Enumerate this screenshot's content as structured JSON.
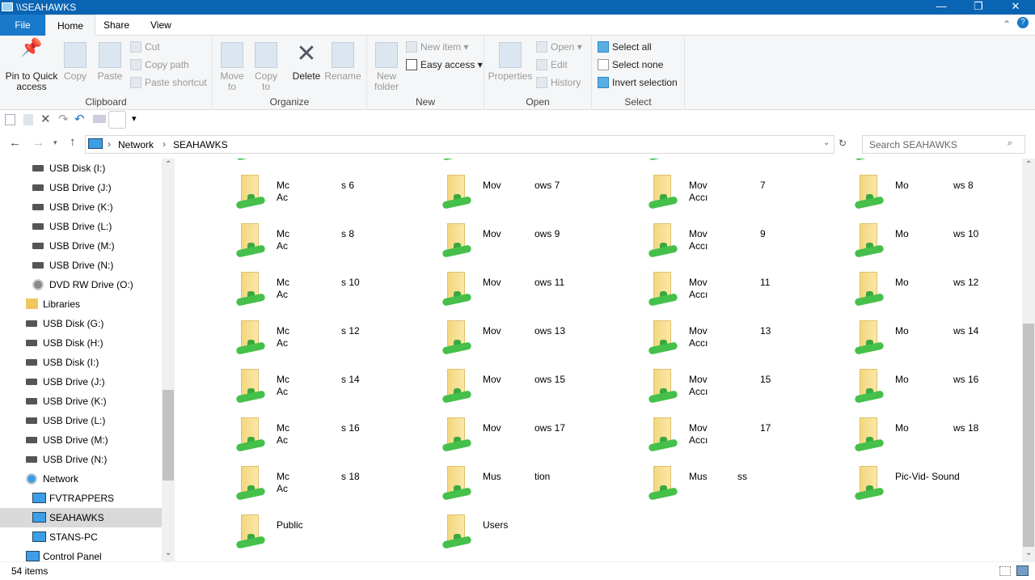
{
  "window": {
    "title": "\\\\SEAHAWKS",
    "minimize": "—",
    "maximize": "❐",
    "close": "✕"
  },
  "tabs": [
    {
      "label": "File"
    },
    {
      "label": "Home"
    },
    {
      "label": "Share"
    },
    {
      "label": "View"
    }
  ],
  "ribbon": {
    "clipboard": {
      "label": "Clipboard",
      "pin": "Pin to Quick access",
      "copy": "Copy",
      "paste": "Paste",
      "cut": "Cut",
      "copy_path": "Copy path",
      "paste_shortcut": "Paste shortcut"
    },
    "organize": {
      "label": "Organize",
      "move_to": "Move to",
      "copy_to": "Copy to",
      "delete": "Delete",
      "rename": "Rename"
    },
    "new": {
      "label": "New",
      "new_folder": "New folder",
      "new_item": "New item",
      "easy_access": "Easy access"
    },
    "open": {
      "label": "Open",
      "properties": "Properties",
      "open": "Open",
      "edit": "Edit",
      "history": "History"
    },
    "select": {
      "label": "Select",
      "select_all": "Select all",
      "select_none": "Select none",
      "invert": "Invert selection"
    }
  },
  "address": {
    "crumbs": [
      "Network",
      "SEAHAWKS"
    ],
    "search_placeholder": "Search SEAHAWKS"
  },
  "nav": [
    {
      "label": "USB Disk (I:)",
      "icon": "drive",
      "indent": 1
    },
    {
      "label": "USB Drive (J:)",
      "icon": "drive",
      "indent": 1
    },
    {
      "label": "USB Drive (K:)",
      "icon": "drive",
      "indent": 1
    },
    {
      "label": "USB Drive (L:)",
      "icon": "drive",
      "indent": 1
    },
    {
      "label": "USB Drive (M:)",
      "icon": "drive",
      "indent": 1
    },
    {
      "label": "USB Drive (N:)",
      "icon": "drive",
      "indent": 1
    },
    {
      "label": "DVD RW Drive (O:)",
      "icon": "dvd",
      "indent": 1
    },
    {
      "label": "Libraries",
      "icon": "library",
      "indent": 0
    },
    {
      "label": "USB Disk (G:)",
      "icon": "drive",
      "indent": 0
    },
    {
      "label": "USB Disk (H:)",
      "icon": "drive",
      "indent": 0
    },
    {
      "label": "USB Disk (I:)",
      "icon": "drive",
      "indent": 0
    },
    {
      "label": "USB Drive (J:)",
      "icon": "drive",
      "indent": 0
    },
    {
      "label": "USB Drive (K:)",
      "icon": "drive",
      "indent": 0
    },
    {
      "label": "USB Drive (L:)",
      "icon": "drive",
      "indent": 0
    },
    {
      "label": "USB Drive (M:)",
      "icon": "drive",
      "indent": 0
    },
    {
      "label": "USB Drive (N:)",
      "icon": "drive",
      "indent": 0
    },
    {
      "label": "Network",
      "icon": "network",
      "indent": 0
    },
    {
      "label": "FVTRAPPERS",
      "icon": "computer",
      "indent": 1
    },
    {
      "label": "SEAHAWKS",
      "icon": "computer",
      "indent": 1,
      "selected": true
    },
    {
      "label": "STANS-PC",
      "icon": "computer",
      "indent": 1
    },
    {
      "label": "Control Panel",
      "icon": "control",
      "indent": 0
    }
  ],
  "rows": [
    [
      {
        "a": "Mc",
        "b": "Ac",
        "r": "s 6"
      },
      {
        "a": "Mov",
        "r": "ows 7"
      },
      {
        "a": "Mov",
        "b": "Accı",
        "r": "7"
      },
      {
        "a": "Mo",
        "r": "ws 8"
      }
    ],
    [
      {
        "a": "Mc",
        "b": "Ac",
        "r": "s 8"
      },
      {
        "a": "Mov",
        "r": "ows 9"
      },
      {
        "a": "Mov",
        "b": "Accı",
        "r": "9"
      },
      {
        "a": "Mo",
        "r": "ws 10"
      }
    ],
    [
      {
        "a": "Mc",
        "b": "Ac",
        "r": "s 10"
      },
      {
        "a": "Mov",
        "r": "ows 11"
      },
      {
        "a": "Mov",
        "b": "Accı",
        "r": "11"
      },
      {
        "a": "Mo",
        "r": "ws 12"
      }
    ],
    [
      {
        "a": "Mc",
        "b": "Ac",
        "r": "s 12"
      },
      {
        "a": "Mov",
        "r": "ows 13"
      },
      {
        "a": "Mov",
        "b": "Accı",
        "r": "13"
      },
      {
        "a": "Mo",
        "r": "ws 14"
      }
    ],
    [
      {
        "a": "Mc",
        "b": "Ac",
        "r": "s 14"
      },
      {
        "a": "Mov",
        "r": "ows 15"
      },
      {
        "a": "Mov",
        "b": "Accı",
        "r": "15"
      },
      {
        "a": "Mo",
        "r": "ws 16"
      }
    ],
    [
      {
        "a": "Mc",
        "b": "Ac",
        "r": "s 16"
      },
      {
        "a": "Mov",
        "r": "ows 17"
      },
      {
        "a": "Mov",
        "b": "Accı",
        "r": "17"
      },
      {
        "a": "Mo",
        "r": "ws 18"
      }
    ],
    [
      {
        "a": "Mc",
        "b": "Ac",
        "r": "s 18"
      },
      {
        "a": "Mus",
        "r": "tion"
      },
      {
        "a": "Mus",
        "r": "ss",
        "x": true
      },
      {
        "a": "Pic-Vid- Sound"
      }
    ],
    [
      {
        "a": "Public"
      },
      {
        "a": "Users"
      }
    ]
  ],
  "status": {
    "count": "54 items"
  }
}
